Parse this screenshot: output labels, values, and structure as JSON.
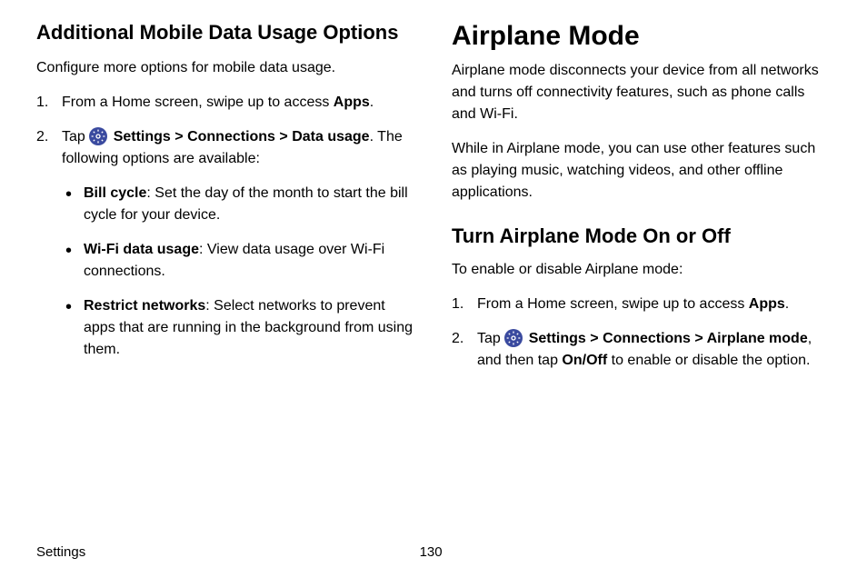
{
  "left": {
    "heading": "Additional Mobile Data Usage Options",
    "intro": "Configure more options for mobile data usage.",
    "step1_pre": "From a Home screen, swipe up to access ",
    "step1_bold": "Apps",
    "step1_post": ".",
    "step2_tap": "Tap ",
    "step2_settings": "Settings",
    "step2_gt1": " > ",
    "step2_connections": "Connections",
    "step2_gt2": " > ",
    "step2_datausage": "Data usage",
    "step2_post": ". The following options are available:",
    "bullets": [
      {
        "bold": "Bill cycle",
        "text": ": Set the day of the month to start the bill cycle for your device."
      },
      {
        "bold": "Wi-Fi data usage",
        "text": ": View data usage over Wi-Fi connections."
      },
      {
        "bold": "Restrict networks",
        "text": ": Select networks to prevent apps that are running in the background from using them."
      }
    ]
  },
  "right": {
    "heading": "Airplane Mode",
    "para1": "Airplane mode disconnects your device from all networks and turns off connectivity features, such as phone calls and Wi-Fi.",
    "para2": "While in Airplane mode, you can use other features such as playing music, watching videos, and other offline applications.",
    "subheading": "Turn Airplane Mode On or Off",
    "intro2": "To enable or disable Airplane mode:",
    "step1_pre": "From a Home screen, swipe up to access ",
    "step1_bold": "Apps",
    "step1_post": ".",
    "step2_tap": "Tap ",
    "step2_settings": "Settings",
    "step2_gt1": " > ",
    "step2_connections": "Connections",
    "step2_gt2": " > ",
    "step2_airplane": "Airplane mode",
    "step2_mid": ", and then tap ",
    "step2_onoff": "On/Off",
    "step2_post": " to enable or disable the option."
  },
  "footer": {
    "label": "Settings",
    "page": "130"
  }
}
